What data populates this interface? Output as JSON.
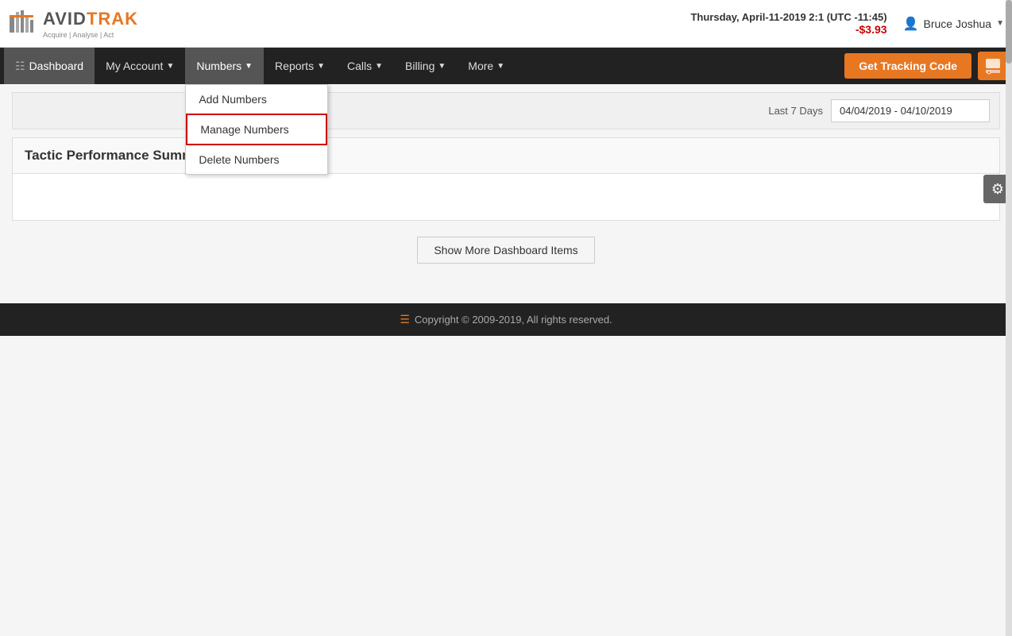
{
  "app": {
    "name": "AvidTrak",
    "logo_sub": "Acquire | Analyse | Act"
  },
  "topbar": {
    "datetime": "Thursday, April-11-2019 2:1 (UTC -11:45)",
    "balance": "-$3.93",
    "user_name": "Bruce Joshua"
  },
  "navbar": {
    "dashboard_label": "Dashboard",
    "my_account_label": "My Account",
    "numbers_label": "Numbers",
    "reports_label": "Reports",
    "calls_label": "Calls",
    "billing_label": "Billing",
    "more_label": "More",
    "get_tracking_label": "Get Tracking Code"
  },
  "numbers_dropdown": {
    "items": [
      {
        "label": "Add Numbers",
        "highlighted": false
      },
      {
        "label": "Manage Numbers",
        "highlighted": true
      },
      {
        "label": "Delete Numbers",
        "highlighted": false
      }
    ]
  },
  "filter": {
    "label": "Last 7 Days",
    "date_range": "04/04/2019 - 04/10/2019"
  },
  "section": {
    "title": "Tactic Performance Summary"
  },
  "show_more_btn": "Show More Dashboard Items",
  "footer": {
    "copyright": "Copyright © 2009-2019, All rights reserved."
  }
}
